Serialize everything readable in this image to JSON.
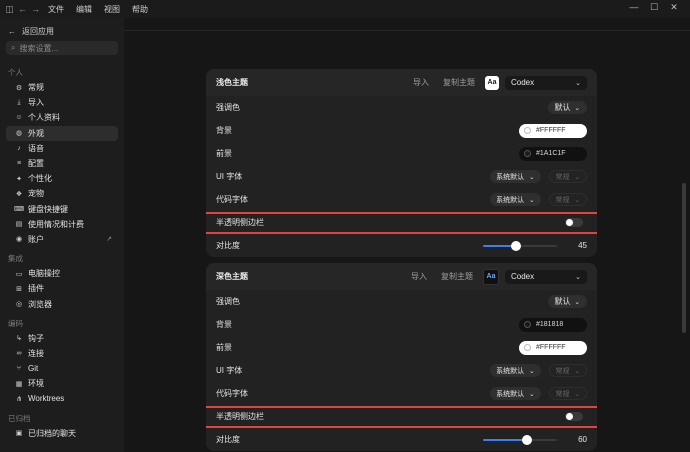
{
  "titlebar": {
    "menu": [
      "文件",
      "编辑",
      "视图",
      "帮助"
    ]
  },
  "sidebar": {
    "back_label": "返回应用",
    "search_placeholder": "搜索设置...",
    "sections": [
      {
        "label": "个人",
        "items": [
          {
            "label": "常规",
            "icon": "gear-icon"
          },
          {
            "label": "导入",
            "icon": "download-icon"
          },
          {
            "label": "个人资料",
            "icon": "user-icon"
          },
          {
            "label": "外观",
            "icon": "palette-icon",
            "active": true
          },
          {
            "label": "语音",
            "icon": "microphone-icon"
          },
          {
            "label": "配置",
            "icon": "sliders-icon"
          },
          {
            "label": "个性化",
            "icon": "sparkle-icon"
          },
          {
            "label": "宠物",
            "icon": "pet-icon"
          },
          {
            "label": "键盘快捷键",
            "icon": "keyboard-icon"
          },
          {
            "label": "使用情况和计费",
            "icon": "chart-icon"
          },
          {
            "label": "账户",
            "icon": "account-icon",
            "external": true
          }
        ]
      },
      {
        "label": "集成",
        "items": [
          {
            "label": "电脑操控",
            "icon": "computer-icon"
          },
          {
            "label": "插件",
            "icon": "plugin-icon"
          },
          {
            "label": "浏览器",
            "icon": "browser-icon"
          }
        ]
      },
      {
        "label": "编码",
        "items": [
          {
            "label": "钩子",
            "icon": "hook-icon"
          },
          {
            "label": "连接",
            "icon": "link-icon"
          },
          {
            "label": "Git",
            "icon": "git-icon"
          },
          {
            "label": "环境",
            "icon": "environment-icon"
          },
          {
            "label": "Worktrees",
            "icon": "worktree-icon"
          }
        ]
      },
      {
        "label": "已归档",
        "items": [
          {
            "label": "已归档的聊天",
            "icon": "archive-icon"
          }
        ]
      }
    ]
  },
  "light_theme": {
    "title": "浅色主题",
    "import_label": "导入",
    "copy_label": "复制主题",
    "preview_glyph": "Aa",
    "theme_name": "Codex",
    "accent_label": "强调色",
    "accent_value": "默认",
    "background_label": "背景",
    "background_value": "#FFFFFF",
    "foreground_label": "前景",
    "foreground_value": "#1A1C1F",
    "ui_font_label": "UI 字体",
    "ui_font_value": "系统默认",
    "ui_font_weight": "常规",
    "code_font_label": "代码字体",
    "code_font_value": "系统默认",
    "code_font_weight": "常规",
    "translucent_label": "半透明侧边栏",
    "translucent_on": false,
    "contrast_label": "对比度",
    "contrast_value": "45",
    "contrast_percent": 45
  },
  "dark_theme": {
    "title": "深色主题",
    "import_label": "导入",
    "copy_label": "复制主题",
    "preview_glyph": "Aa",
    "theme_name": "Codex",
    "accent_label": "强调色",
    "accent_value": "默认",
    "background_label": "背景",
    "background_value": "#181818",
    "foreground_label": "前景",
    "foreground_value": "#FFFFFF",
    "ui_font_label": "UI 字体",
    "ui_font_value": "系统默认",
    "ui_font_weight": "常规",
    "code_font_label": "代码字体",
    "code_font_value": "系统默认",
    "code_font_weight": "常规",
    "translucent_label": "半透明侧边栏",
    "translucent_on": false,
    "contrast_label": "对比度",
    "contrast_value": "60",
    "contrast_percent": 60
  },
  "colors": {
    "accent": "#3d7ef0",
    "highlight": "#e0443e"
  }
}
